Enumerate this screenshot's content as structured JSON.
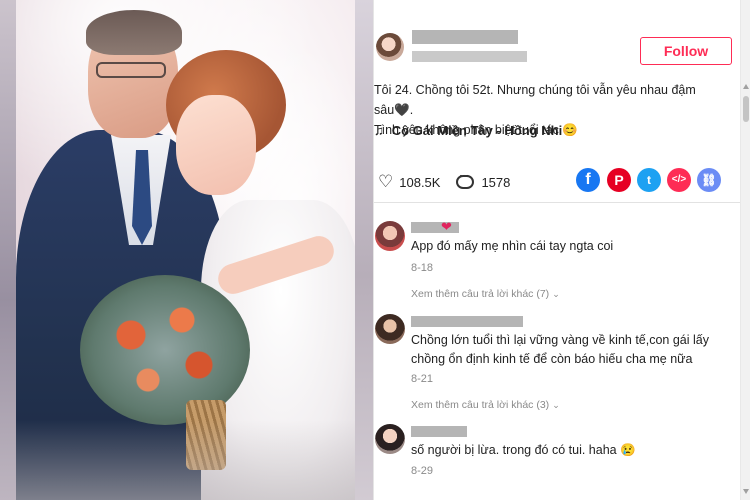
{
  "video": {
    "description_icon": "wedding-photo"
  },
  "post": {
    "follow_label": "Follow",
    "caption_line1": "Tôi 24. Chồng tôi 52t. Nhưng chúng tôi vẫn yêu nhau đậm sâu🖤.",
    "caption_line2": "Tình yêu không phân biệt tuổi tác 😊",
    "music_icon": "music-note-icon",
    "music_title": "Cô Gái Miền Tây - Hồng Nhi",
    "likes": "108.5K",
    "comments": "1578",
    "share": {
      "facebook": "f",
      "pinterest": "P",
      "twitter": "t",
      "embed": "</>",
      "link": "⛓"
    }
  },
  "comments": [
    {
      "text": "App đó mấy mẹ nhìn cái tay ngta coi",
      "date": "8-18",
      "more": "Xem thêm câu trả lời khác (7)"
    },
    {
      "text_line1": "Chồng lớn tuổi thì lại vững vàng về kinh tế,con gái lấy",
      "text_line2": "chồng ổn định kinh tế để còn báo hiếu cha mẹ nữa",
      "date": "8-21",
      "more": "Xem thêm câu trả lời khác (3)"
    },
    {
      "text": "số người bị lừa. trong đó có tui. haha 😢",
      "date": "8-29"
    }
  ],
  "colors": {
    "follow": "#fe2c55",
    "facebook": "#1877f2",
    "pinterest": "#e60023",
    "twitter": "#1da1f2"
  }
}
